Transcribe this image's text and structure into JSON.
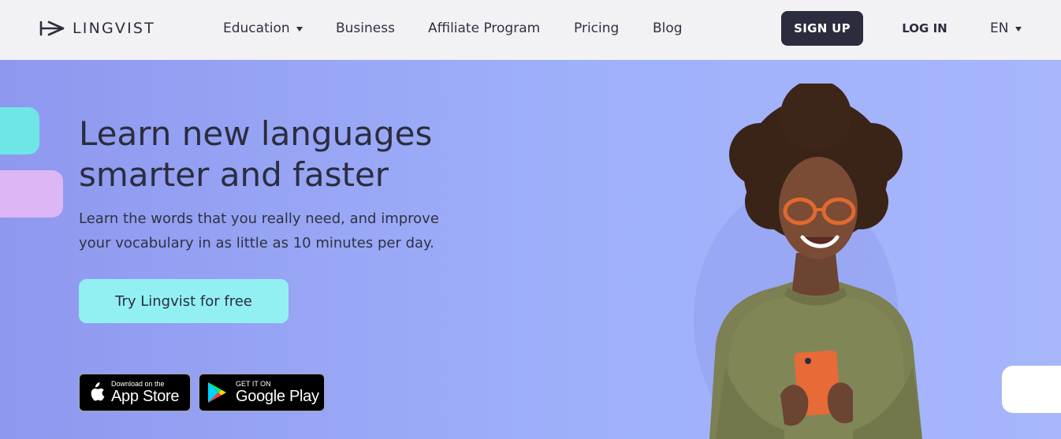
{
  "header": {
    "logo_text": "LINGVIST",
    "nav": [
      {
        "label": "Education",
        "has_dropdown": true
      },
      {
        "label": "Business",
        "has_dropdown": false
      },
      {
        "label": "Affiliate Program",
        "has_dropdown": false
      },
      {
        "label": "Pricing",
        "has_dropdown": false
      },
      {
        "label": "Blog",
        "has_dropdown": false
      }
    ],
    "signup_label": "SIGN UP",
    "login_label": "LOG IN",
    "language": "EN"
  },
  "hero": {
    "headline_line1": "Learn new languages",
    "headline_line2": "smarter and faster",
    "subline_line1": "Learn the words that you really need, and improve",
    "subline_line2": "your vocabulary in as little as 10 minutes per day.",
    "cta_label": "Try Lingvist for free",
    "app_store": {
      "small": "Download on the",
      "big": "App Store"
    },
    "google_play": {
      "small": "GET IT ON",
      "big": "Google Play"
    }
  },
  "colors": {
    "header_bg": "#f2f2f4",
    "dark": "#2b2d3e",
    "hero_bg": "#9fb0fb",
    "cta_bg": "#92f0f3",
    "deco_cyan": "#6ee6e6",
    "deco_pink": "#dcb6f5"
  }
}
